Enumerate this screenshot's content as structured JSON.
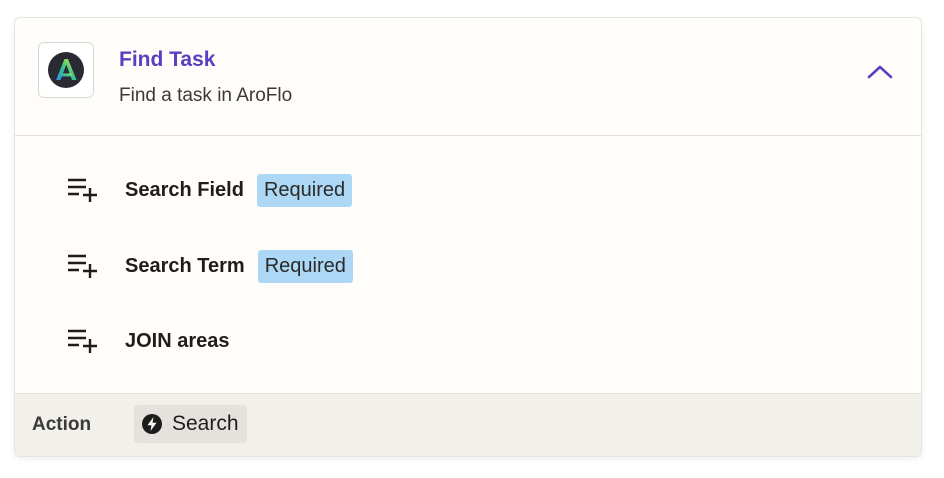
{
  "step": {
    "title": "Find Task",
    "subtitle": "Find a task in AroFlo",
    "app_icon": "aroflo-logo-icon",
    "collapse_icon": "chevron-up-icon",
    "accent_color": "#5a3fc0"
  },
  "fields": [
    {
      "label": "Search Field",
      "badge": "Required",
      "icon": "add-field-icon"
    },
    {
      "label": "Search Term",
      "badge": "Required",
      "icon": "add-field-icon"
    },
    {
      "label": "JOIN areas",
      "badge": null,
      "icon": "add-field-icon"
    }
  ],
  "badge_color": "#add8f5",
  "footer": {
    "label": "Action",
    "chip_label": "Search",
    "chip_icon": "bolt-icon"
  }
}
